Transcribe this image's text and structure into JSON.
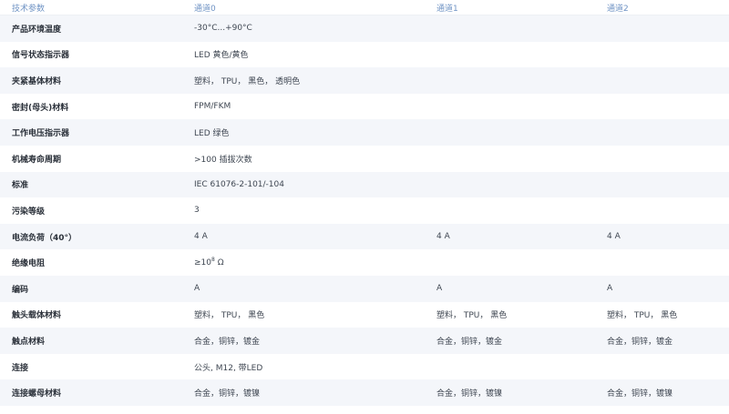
{
  "header": {
    "param_col": "技术参数",
    "ch0": "通道0",
    "ch1": "通道1",
    "ch2": "通道2"
  },
  "rows": [
    {
      "name": "产品环境温度",
      "ch0": "-30°C...+90°C",
      "ch1": "",
      "ch2": ""
    },
    {
      "name": "信号状态指示器",
      "ch0": "LED 黄色/黄色",
      "ch1": "",
      "ch2": ""
    },
    {
      "name": "夹紧基体材料",
      "ch0": "塑料， TPU， 黑色， 透明色",
      "ch1": "",
      "ch2": ""
    },
    {
      "name": "密封(母头)材料",
      "ch0": "FPM/FKM",
      "ch1": "",
      "ch2": ""
    },
    {
      "name": "工作电压指示器",
      "ch0": "LED 绿色",
      "ch1": "",
      "ch2": ""
    },
    {
      "name": "机械寿命周期",
      "ch0": ">100 插拔次数",
      "ch1": "",
      "ch2": ""
    },
    {
      "name": "标准",
      "ch0": "IEC 61076-2-101/-104",
      "ch1": "",
      "ch2": ""
    },
    {
      "name": "污染等级",
      "ch0": "3",
      "ch1": "",
      "ch2": ""
    },
    {
      "name": "电流负荷（40°）",
      "ch0": "4 A",
      "ch1": "4 A",
      "ch2": "4 A"
    },
    {
      "name": "绝缘电阻",
      "ch0_prefix": "≥10",
      "ch0_sup": "8",
      "ch0_suffix": " Ω",
      "ch1": "",
      "ch2": ""
    },
    {
      "name": "编码",
      "ch0": "A",
      "ch1": "A",
      "ch2": "A"
    },
    {
      "name": "触头载体材料",
      "ch0": "塑料， TPU， 黑色",
      "ch1": "塑料， TPU， 黑色",
      "ch2": "塑料， TPU， 黑色"
    },
    {
      "name": "触点材料",
      "ch0": "合金，铜锌，镀金",
      "ch1": "合金，铜锌，镀金",
      "ch2": "合金，铜锌，镀金"
    },
    {
      "name": "连接",
      "ch0": "公头, M12, 带LED",
      "ch1": "",
      "ch2": ""
    },
    {
      "name": "连接螺母材料",
      "ch0": "合金，铜锌，镀镍",
      "ch1": "合金，铜锌，镀镍",
      "ch2": "合金，铜锌，镀镍"
    }
  ]
}
